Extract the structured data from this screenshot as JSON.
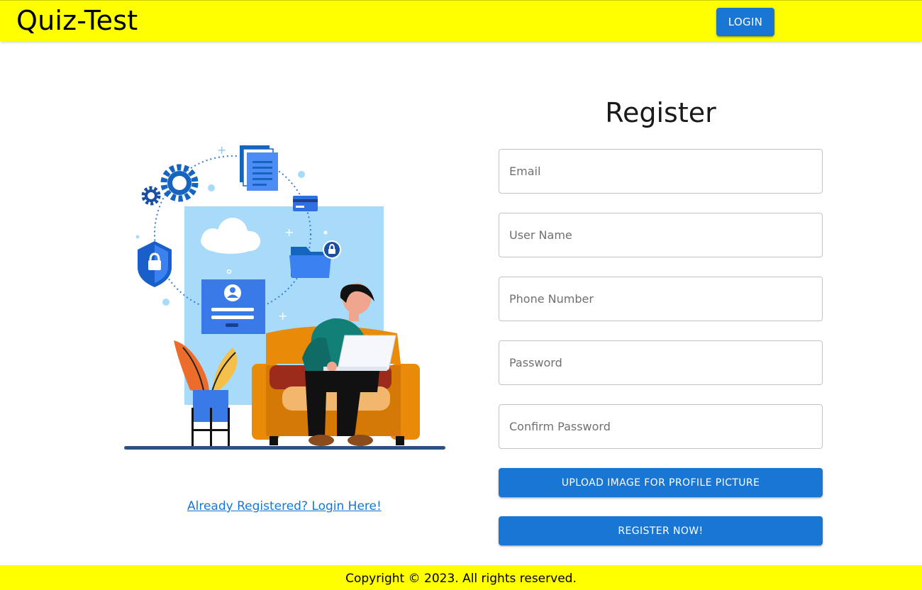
{
  "header": {
    "brand": "Quiz-Test",
    "login_label": "LOGIN"
  },
  "form": {
    "title": "Register",
    "email_placeholder": "Email",
    "username_placeholder": "User Name",
    "phone_placeholder": "Phone Number",
    "password_placeholder": "Password",
    "confirm_password_placeholder": "Confirm Password",
    "upload_label": "UPLOAD IMAGE FOR PROFILE PICTURE",
    "register_label": "REGISTER NOW!"
  },
  "login_link": "Already Registered? Login Here!",
  "footer": {
    "copyright": "Copyright © 2023. All rights reserved."
  },
  "colors": {
    "appbar": "#ffff00",
    "primary": "#1976d2",
    "illustration_panel": "#a8daf9",
    "sofa": "#e98a08"
  }
}
